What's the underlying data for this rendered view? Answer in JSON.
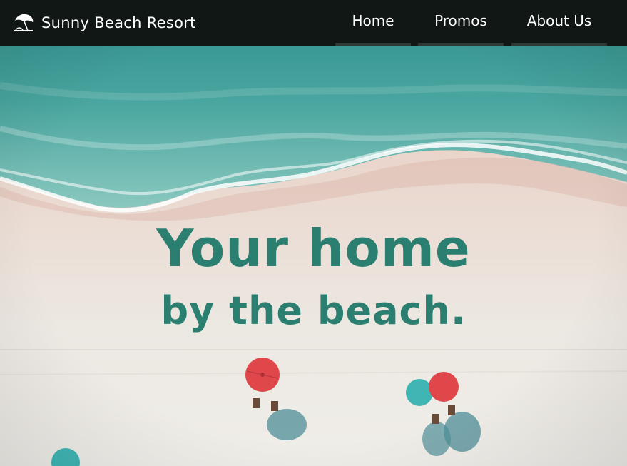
{
  "brand": {
    "name": "Sunny Beach Resort",
    "logo_icon": "beach-umbrella-icon"
  },
  "nav": {
    "items": [
      {
        "label": "Home"
      },
      {
        "label": "Promos"
      },
      {
        "label": "About Us"
      }
    ]
  },
  "hero": {
    "headline_line1": "Your home",
    "headline_line2": "by the beach.",
    "text_color": "#2b7f70"
  },
  "colors": {
    "navbar_bg": "#101715",
    "sea": "#3a9a96",
    "sand": "#ece6dd",
    "umbrella_red": "#e0474b",
    "umbrella_teal": "#3fb6b4"
  }
}
